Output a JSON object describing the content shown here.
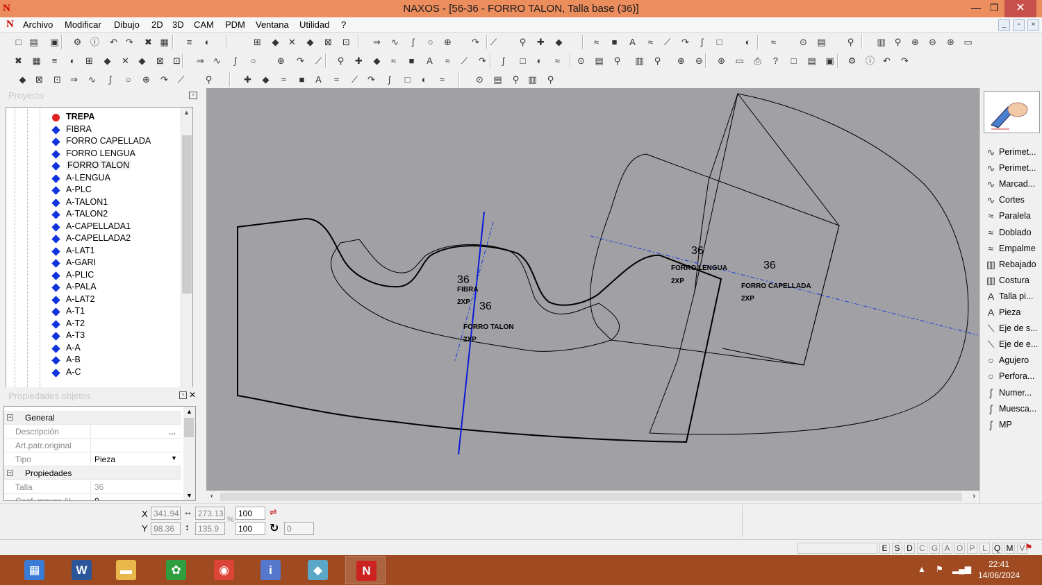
{
  "window": {
    "title": "NAXOS - [56-36 - FORRO TALON, Talla base (36)]",
    "logo": "N",
    "min": "—",
    "max": "❐",
    "close": "✕"
  },
  "menu": [
    "Archivo",
    "Modificar",
    "Dibujo",
    "2D",
    "3D",
    "CAM",
    "PDM",
    "Ventana",
    "Utilidad",
    "?"
  ],
  "project": {
    "title": "Proyecto",
    "items": [
      {
        "label": "TREPA",
        "color": "#e02020"
      },
      {
        "label": "FIBRA"
      },
      {
        "label": "FORRO CAPELLADA"
      },
      {
        "label": "FORRO LENGUA"
      },
      {
        "label": "FORRO TALON"
      },
      {
        "label": "A-LENGUA"
      },
      {
        "label": "A-PLC"
      },
      {
        "label": "A-TALON1"
      },
      {
        "label": "A-TALON2"
      },
      {
        "label": "A-CAPELLADA1"
      },
      {
        "label": "A-CAPELLADA2"
      },
      {
        "label": "A-LAT1"
      },
      {
        "label": "A-GARI"
      },
      {
        "label": "A-PLIC"
      },
      {
        "label": "A-PALA"
      },
      {
        "label": "A-LAT2"
      },
      {
        "label": "A-T1"
      },
      {
        "label": "A-T2"
      },
      {
        "label": "A-T3"
      },
      {
        "label": "A-A"
      },
      {
        "label": "A-B"
      },
      {
        "label": "A-C"
      }
    ]
  },
  "properties": {
    "title": "Propiedades objetos",
    "general_label": "General",
    "rows": [
      {
        "key": "Descripción",
        "value": "...",
        "dim": true
      },
      {
        "key": "Art.patr.original",
        "value": "",
        "dim": true
      },
      {
        "key": "Tipo",
        "value": "Pieza",
        "dropdown": true
      }
    ],
    "propiedades_label": "Propiedades",
    "rows2": [
      {
        "key": "Talla",
        "value": "36",
        "dim": true
      },
      {
        "key": "Coef. mayor. %",
        "value": "0",
        "dim": false
      }
    ]
  },
  "canvas": {
    "pieces": [
      {
        "size": "36",
        "name": "FIBRA",
        "qty": "2XP"
      },
      {
        "size": "36",
        "name": "FORRO TALON",
        "qty": "2XP"
      },
      {
        "size": "36",
        "name": "FORRO LENGUA",
        "qty": "2XP"
      },
      {
        "size": "36",
        "name": "FORRO CAPELLADA",
        "qty": "2XP"
      }
    ]
  },
  "tools": [
    {
      "icon": "perimeter-icon",
      "glyph": "∿",
      "label": "Perimet..."
    },
    {
      "icon": "perimeter-icon",
      "glyph": "∿",
      "label": "Perimet..."
    },
    {
      "icon": "mark-icon",
      "glyph": "∿",
      "label": "Marcad..."
    },
    {
      "icon": "cut-icon",
      "glyph": "∿",
      "label": "Cortes"
    },
    {
      "icon": "parallel-icon",
      "glyph": "≈",
      "label": "Paralela"
    },
    {
      "icon": "fold-icon",
      "glyph": "≈",
      "label": "Doblado"
    },
    {
      "icon": "join-icon",
      "glyph": "≈",
      "label": "Empalme"
    },
    {
      "icon": "skive-icon",
      "glyph": "▥",
      "label": "Rebajado"
    },
    {
      "icon": "seam-icon",
      "glyph": "▥",
      "label": "Costura"
    },
    {
      "icon": "size-text-icon",
      "glyph": "A",
      "label": "Talla pi..."
    },
    {
      "icon": "piece-text-icon",
      "glyph": "A",
      "label": "Pieza"
    },
    {
      "icon": "axis-icon",
      "glyph": "⟍",
      "label": "Eje de s..."
    },
    {
      "icon": "axis-icon",
      "glyph": "⟍",
      "label": "Eje de e..."
    },
    {
      "icon": "hole-icon",
      "glyph": "○",
      "label": "Agujero"
    },
    {
      "icon": "perforation-icon",
      "glyph": "○",
      "label": "Perfora..."
    },
    {
      "icon": "number-icon",
      "glyph": "∫",
      "label": "Numer..."
    },
    {
      "icon": "notch-icon",
      "glyph": "∫",
      "label": "Muesca..."
    },
    {
      "icon": "mp-icon",
      "glyph": "∫",
      "label": "MP"
    }
  ],
  "coords": {
    "x_label": "X",
    "y_label": "Y",
    "x": "341.94",
    "y": "98.36",
    "w": "273.13",
    "h": "135.9",
    "sx": "100",
    "sy": "100",
    "rot": "0",
    "pct": "%"
  },
  "status_letters": [
    "E",
    "S",
    "D",
    "C",
    "G",
    "A",
    "O",
    "P",
    "L",
    "Q",
    "M",
    "V"
  ],
  "status_active": [
    "E",
    "S",
    "D",
    "Q",
    "M"
  ],
  "taskbar": {
    "time": "22:41",
    "date": "14/06/2024",
    "apps": [
      {
        "name": "calculator-app",
        "glyph": "▦",
        "color": "#3a7bd5"
      },
      {
        "name": "word-app",
        "glyph": "W",
        "color": "#2b579a"
      },
      {
        "name": "explorer-app",
        "glyph": "▬",
        "color": "#e8b84a"
      },
      {
        "name": "leaf-app",
        "glyph": "✿",
        "color": "#2e9e3e"
      },
      {
        "name": "chrome-app",
        "glyph": "◉",
        "color": "#db4437"
      },
      {
        "name": "info-app",
        "glyph": "i",
        "color": "#5577cc"
      },
      {
        "name": "cube-app",
        "glyph": "◆",
        "color": "#5aa7c8"
      },
      {
        "name": "naxos-app",
        "glyph": "N",
        "color": "#cc2222"
      }
    ]
  }
}
